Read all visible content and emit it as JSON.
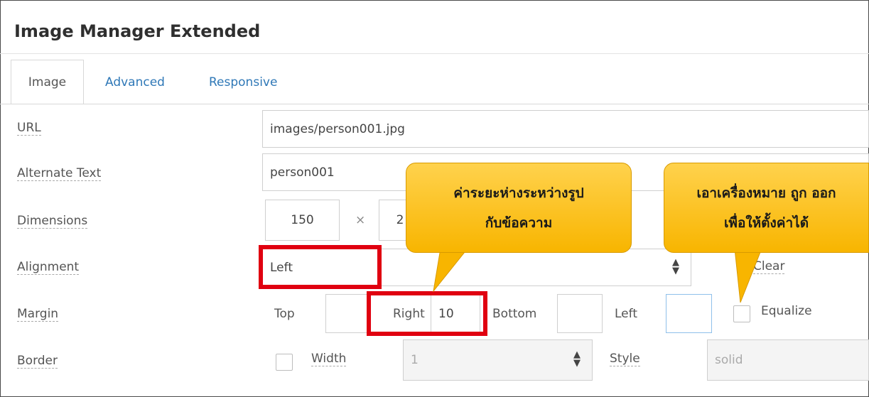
{
  "dialog": {
    "title": "Image Manager Extended"
  },
  "tabs": [
    {
      "label": "Image"
    },
    {
      "label": "Advanced"
    },
    {
      "label": "Responsive"
    }
  ],
  "form": {
    "url": {
      "label": "URL",
      "value": "images/person001.jpg"
    },
    "alt": {
      "label": "Alternate Text",
      "value": "person001"
    },
    "dimensions": {
      "label": "Dimensions",
      "width": "150",
      "separator": "×",
      "height": "2"
    },
    "alignment": {
      "label": "Alignment",
      "value": "Left",
      "clear_label": "Clear"
    },
    "margin": {
      "label": "Margin",
      "top_label": "Top",
      "top_value": "",
      "right_label": "Right",
      "right_value": "10",
      "bottom_label": "Bottom",
      "bottom_value": "",
      "left_label": "Left",
      "left_value": "",
      "equalize_label": "Equalize"
    },
    "border": {
      "label": "Border",
      "width_label": "Width",
      "width_value": "1",
      "style_label": "Style",
      "style_value": "solid"
    }
  },
  "callouts": {
    "margin_note": {
      "line1": "ค่าระยะห่างระหว่างรูป",
      "line2": "กับข้อความ"
    },
    "equalize_note": {
      "line1": "เอาเครื่องหมาย ถูก ออก",
      "line2": "เพื่อให้ตั้งค่าได้"
    }
  },
  "colors": {
    "highlight": "#e00010",
    "callout": "#f8b500",
    "link": "#2f78b7"
  }
}
